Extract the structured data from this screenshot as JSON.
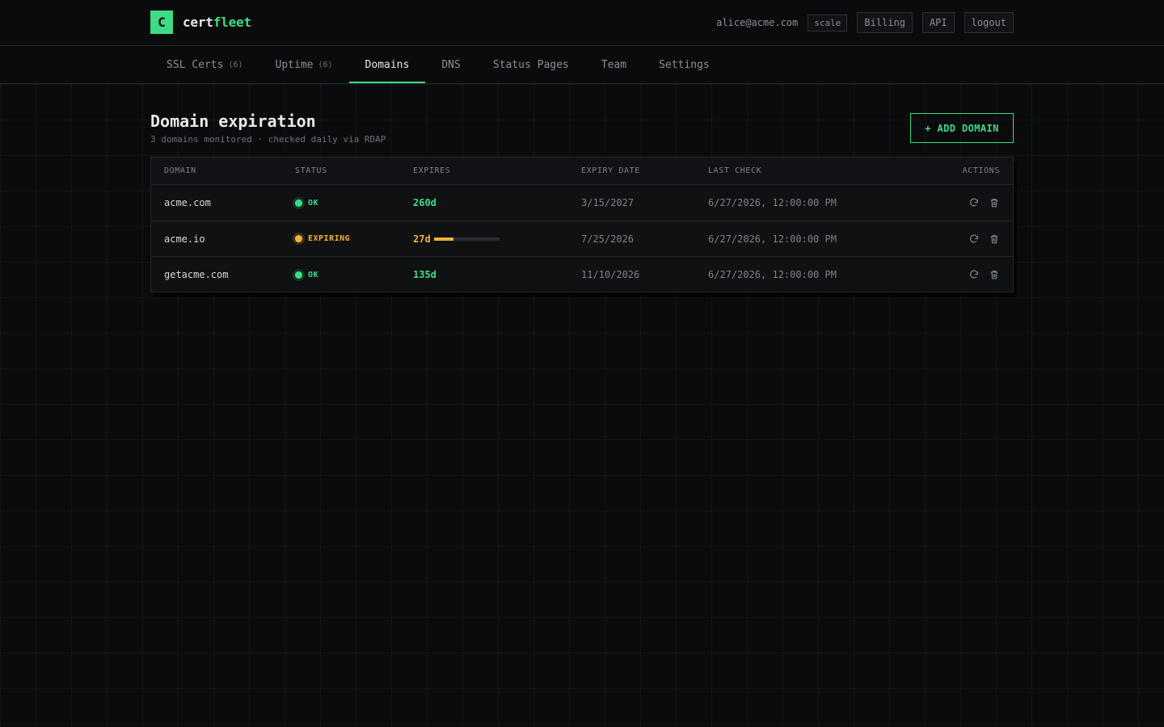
{
  "brand": {
    "logo_letter": "C",
    "name_prefix": "cert",
    "name_suffix": "fleet",
    "accent_color": "#3ddc84"
  },
  "header": {
    "user_email": "alice@acme.com",
    "plan": "scale",
    "billing_label": "Billing",
    "api_label": "API",
    "logout_label": "logout"
  },
  "nav": {
    "tabs": [
      {
        "label": "SSL Certs",
        "count": "(6)",
        "active": false
      },
      {
        "label": "Uptime",
        "count": "(6)",
        "active": false
      },
      {
        "label": "Domains",
        "count": "",
        "active": true
      },
      {
        "label": "DNS",
        "count": "",
        "active": false
      },
      {
        "label": "Status Pages",
        "count": "",
        "active": false
      },
      {
        "label": "Team",
        "count": "",
        "active": false
      },
      {
        "label": "Settings",
        "count": "",
        "active": false
      }
    ]
  },
  "page": {
    "title": "Domain expiration",
    "subtitle": "3 domains monitored · checked daily via RDAP",
    "add_button": "+ ADD DOMAIN"
  },
  "table": {
    "columns": [
      "DOMAIN",
      "STATUS",
      "EXPIRES",
      "EXPIRY DATE",
      "LAST CHECK",
      "ACTIONS"
    ],
    "rows": [
      {
        "domain": "acme.com",
        "status": "OK",
        "expires": "260d",
        "expiry_date": "3/15/2027",
        "last_check": "6/27/2026, 12:00:00 PM",
        "state": "ok"
      },
      {
        "domain": "acme.io",
        "status": "EXPIRING",
        "expires": "27d",
        "expiry_date": "7/25/2026",
        "last_check": "6/27/2026, 12:00:00 PM",
        "state": "warn",
        "expiry_progress": 0.3
      },
      {
        "domain": "getacme.com",
        "status": "OK",
        "expires": "135d",
        "expiry_date": "11/10/2026",
        "last_check": "6/27/2026, 12:00:00 PM",
        "state": "ok"
      }
    ],
    "row_actions": [
      "refresh-icon",
      "trash-icon"
    ]
  },
  "colors": {
    "ok": "#3ddc84",
    "warning": "#f5b13d"
  }
}
